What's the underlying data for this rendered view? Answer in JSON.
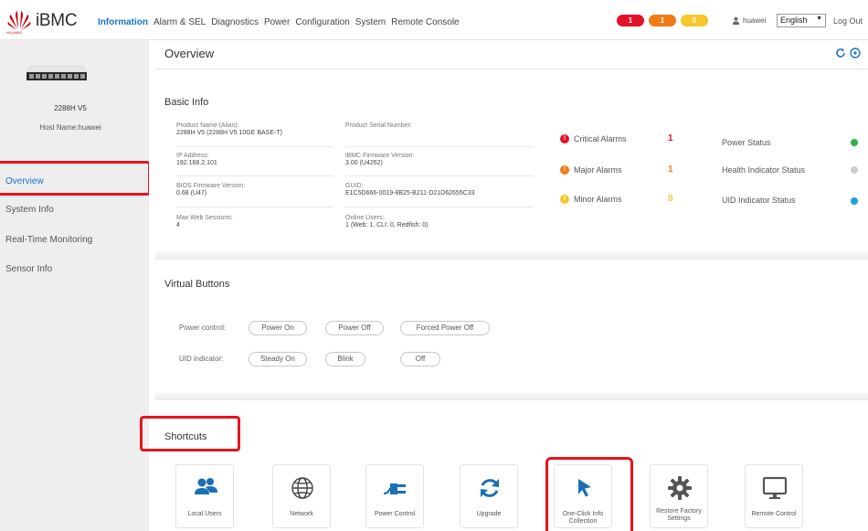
{
  "header": {
    "brand": "iBMC",
    "brand_sub": "HUAWEI",
    "nav": [
      "Information",
      "Alarm & SEL",
      "Diagnostics",
      "Power",
      "Configuration",
      "System",
      "Remote Console"
    ],
    "alarm_pills": [
      "1",
      "1",
      "0"
    ],
    "username": "huawei",
    "language": "English",
    "logout": "Log Out"
  },
  "sidebar": {
    "host_model": "2288H V5",
    "host_name": "Host Name:huawei",
    "items": [
      "Overview",
      "System Info",
      "Real-Time Monitoring",
      "Sensor Info"
    ]
  },
  "main": {
    "title": "Overview",
    "basic_info": {
      "title": "Basic Info",
      "product_name_label": "Product Name (Alias):",
      "product_name_value": "2288H V5 (2288H V5 10GE BASE-T)",
      "serial_label": "Product Serial Number:",
      "serial_value": "",
      "ip_label": "IP Address:",
      "ip_value": "192.168.2.101",
      "fw_label": "iBMC Firmware Version:",
      "fw_value": "3.00 (U4262)",
      "bios_label": "BIOS Firmware Version:",
      "bios_value": "0.68 (U47)",
      "guid_label": "GUID:",
      "guid_value": "E1C5D666-0019-8B25-B211-D21D62655C33",
      "sessions_label": "Max Web Sessions:",
      "sessions_value": "4",
      "online_label": "Online Users:",
      "online_value": "1 (Web: 1, CLI: 0, Redfish: 0)"
    },
    "alarms": [
      {
        "label": "Critical Alarms",
        "count": "1",
        "color": "#e5112a"
      },
      {
        "label": "Major Alarms",
        "count": "1",
        "color": "#f07a16"
      },
      {
        "label": "Minor Alarms",
        "count": "0",
        "color": "#f6c62a"
      }
    ],
    "statuses": [
      {
        "label": "Power Status",
        "color": "#2bb24c"
      },
      {
        "label": "Health Indicator Status",
        "color": "#cccccc"
      },
      {
        "label": "UID Indicator Status",
        "color": "#1aa1e0"
      }
    ],
    "virtual_buttons": {
      "title": "Virtual Buttons",
      "power_label": "Power control:",
      "power_on": "Power On",
      "power_off": "Power Off",
      "forced_off": "Forced Power Off",
      "uid_label": "UID indicator:",
      "steady_on": "Steady On",
      "blink": "Blink",
      "off": "Off"
    },
    "shortcuts": {
      "title": "Shortcuts",
      "tiles": [
        "Local Users",
        "Network",
        "Power Control",
        "Upgrade",
        "One-Click Info Collection",
        "Restore Factory Settings",
        "Remote Control"
      ]
    }
  },
  "colors": {
    "accent": "#1a73c8",
    "highlight": "#e6141e",
    "icon_blue": "#1a6fb5"
  }
}
